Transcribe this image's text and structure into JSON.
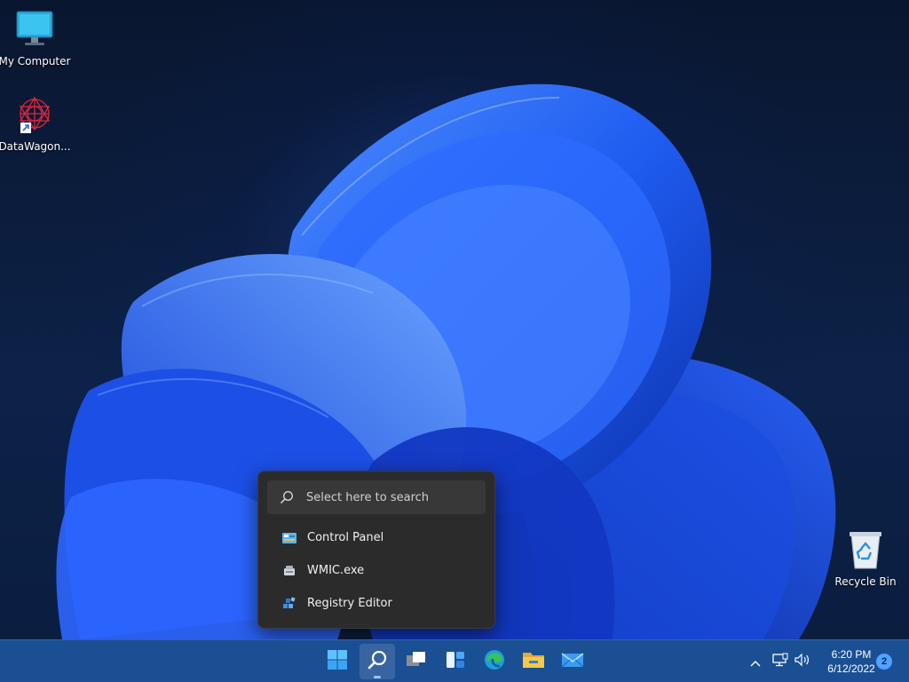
{
  "desktop": {
    "icons": [
      {
        "label": "My Computer",
        "icon": "monitor-icon"
      },
      {
        "label": "DataWagon...",
        "icon": "datawagon-icon",
        "shortcut": true
      },
      {
        "label": "Recycle Bin",
        "icon": "recycle-bin-icon"
      }
    ]
  },
  "search_flyout": {
    "placeholder": "Select here to search",
    "results": [
      {
        "label": "Control Panel",
        "icon": "control-panel-icon"
      },
      {
        "label": "WMIC.exe",
        "icon": "wmic-icon"
      },
      {
        "label": "Registry Editor",
        "icon": "registry-editor-icon"
      }
    ]
  },
  "taskbar": {
    "apps": [
      {
        "name": "Start",
        "icon": "windows-start-icon"
      },
      {
        "name": "Search",
        "icon": "search-icon",
        "active": true
      },
      {
        "name": "Task View",
        "icon": "task-view-icon"
      },
      {
        "name": "Widgets",
        "icon": "widgets-icon"
      },
      {
        "name": "Microsoft Edge",
        "icon": "edge-icon"
      },
      {
        "name": "File Explorer",
        "icon": "file-explorer-icon"
      },
      {
        "name": "Mail",
        "icon": "mail-icon"
      }
    ],
    "tray": {
      "time": "6:20 PM",
      "date": "6/12/2022",
      "notification_count": "2"
    }
  },
  "colors": {
    "taskbar": "#1b4f93",
    "flyout": "#2b2b2b",
    "accent": "#4ea3ff"
  }
}
